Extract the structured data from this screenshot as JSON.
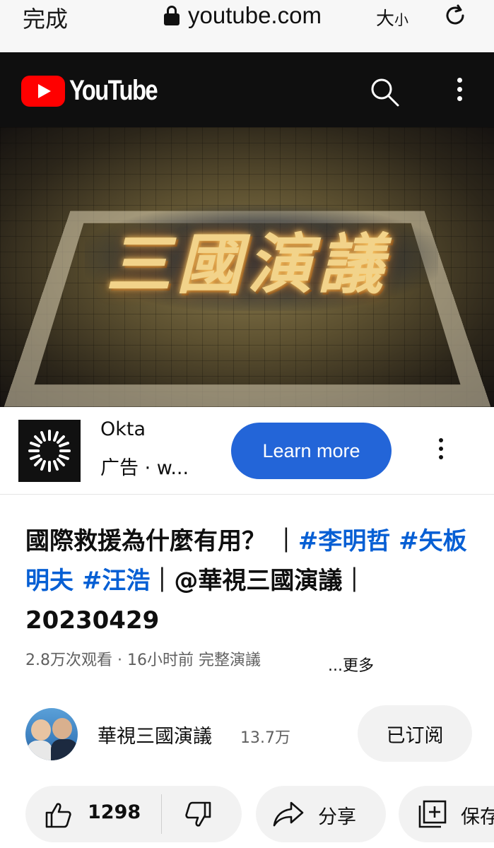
{
  "safari": {
    "done_label": "完成",
    "domain": "youtube.com",
    "text_size_large": "大",
    "text_size_small": "小"
  },
  "header": {
    "logo_text": "YouTube",
    "search_icon": "search-icon",
    "more_icon": "more-vert-icon"
  },
  "video": {
    "overlay_title": "三國演議"
  },
  "ad": {
    "advertiser": "Okta",
    "sublabel": "广告 · w...",
    "cta_label": "Learn more",
    "more_icon": "more-vert-icon"
  },
  "title": {
    "part1": "國際救援為什麼有用？ ｜",
    "tag1": "#李明哲",
    "tag2": " #矢板明夫",
    "tag3": " #汪浩",
    "part2": "｜@華視三國演議｜20230429"
  },
  "meta": {
    "text": "2.8万次观看 · 16小时前  完整演議",
    "more_label": "...更多"
  },
  "channel": {
    "name": "華視三國演議",
    "subscribers": "13.7万",
    "subscribe_label": "已订阅"
  },
  "actions": {
    "like_count": "1298",
    "share_label": "分享",
    "save_label": "保存"
  },
  "colors": {
    "youtube_red": "#ff0000",
    "link_blue": "#065fd4",
    "cta_blue": "#2365d8"
  }
}
